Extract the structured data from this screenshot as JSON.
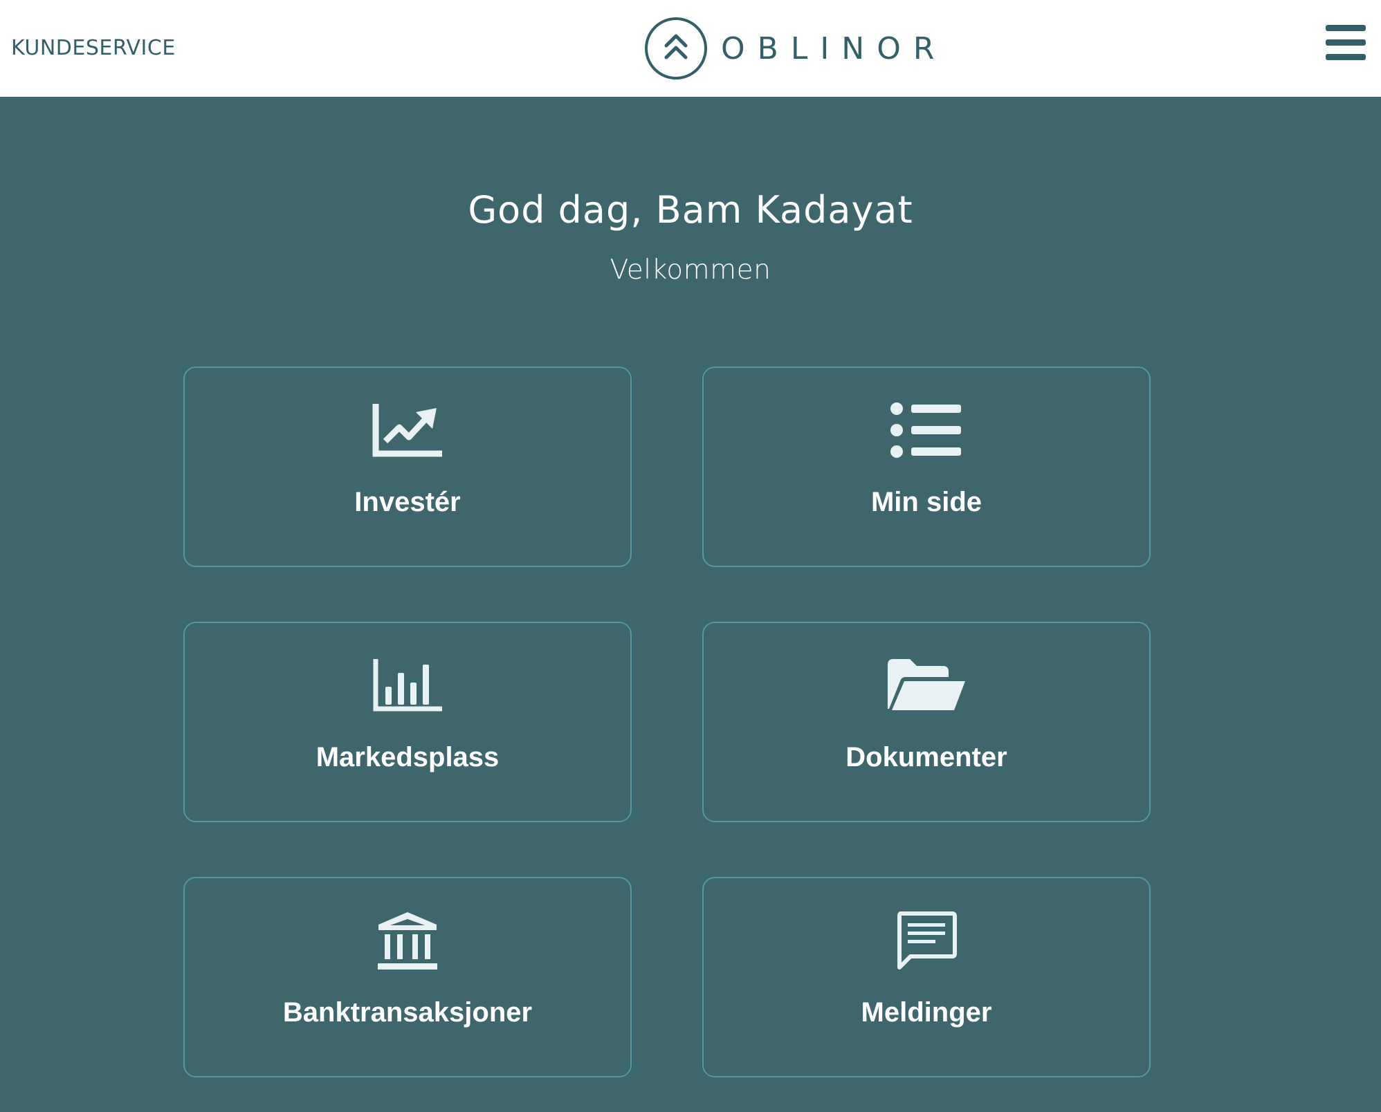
{
  "header": {
    "customer_service": "KUNDESERVICE",
    "brand": "OBLINOR",
    "logo_icon": "double-chevron-up-circle",
    "menu_icon": "hamburger-menu"
  },
  "main": {
    "greeting": "God dag, Bam Kadayat",
    "welcome": "Velkommen"
  },
  "tiles": [
    {
      "label": "Investér",
      "icon": "trending-up-chart-icon"
    },
    {
      "label": "Min side",
      "icon": "list-icon"
    },
    {
      "label": "Markedsplass",
      "icon": "bar-chart-icon"
    },
    {
      "label": "Dokumenter",
      "icon": "folder-open-icon"
    },
    {
      "label": "Banktransaksjoner",
      "icon": "bank-icon"
    },
    {
      "label": "Meldinger",
      "icon": "message-icon"
    }
  ],
  "colors": {
    "background": "#3d666d",
    "header_bg": "#ffffff",
    "brand_color": "#335f68",
    "tile_border": "#4f9aa3",
    "icon_color": "#e8f1f3"
  }
}
